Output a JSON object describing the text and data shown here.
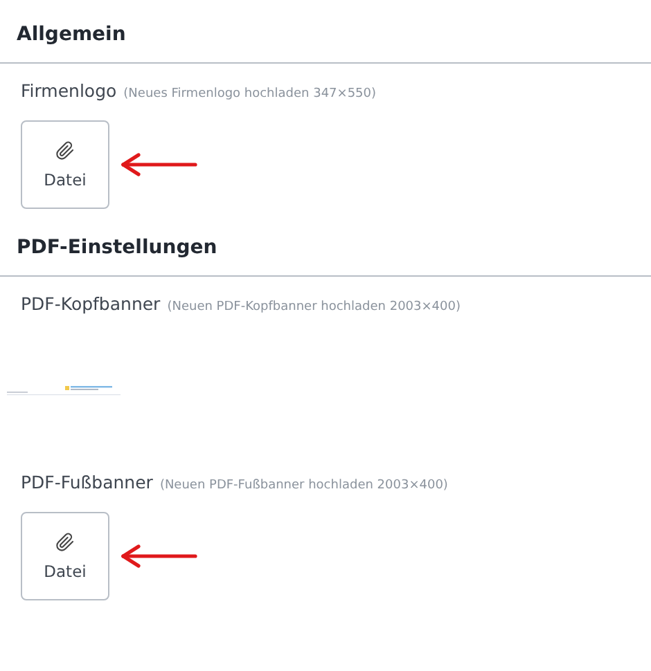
{
  "sections": [
    {
      "title": "Allgemein",
      "fields": [
        {
          "kind": "upload",
          "label": "Firmenlogo",
          "hint": "(Neues Firmenlogo hochladen 347×550)",
          "button": "Datei",
          "annotated": true
        }
      ]
    },
    {
      "title": "PDF-Einstellungen",
      "fields": [
        {
          "kind": "preview",
          "label": "PDF-Kopfbanner",
          "hint": "(Neuen PDF-Kopfbanner hochladen 2003×400)"
        },
        {
          "kind": "upload",
          "label": "PDF-Fußbanner",
          "hint": "(Neuen PDF-Fußbanner hochladen 2003×400)",
          "button": "Datei",
          "annotated": true
        }
      ]
    }
  ]
}
